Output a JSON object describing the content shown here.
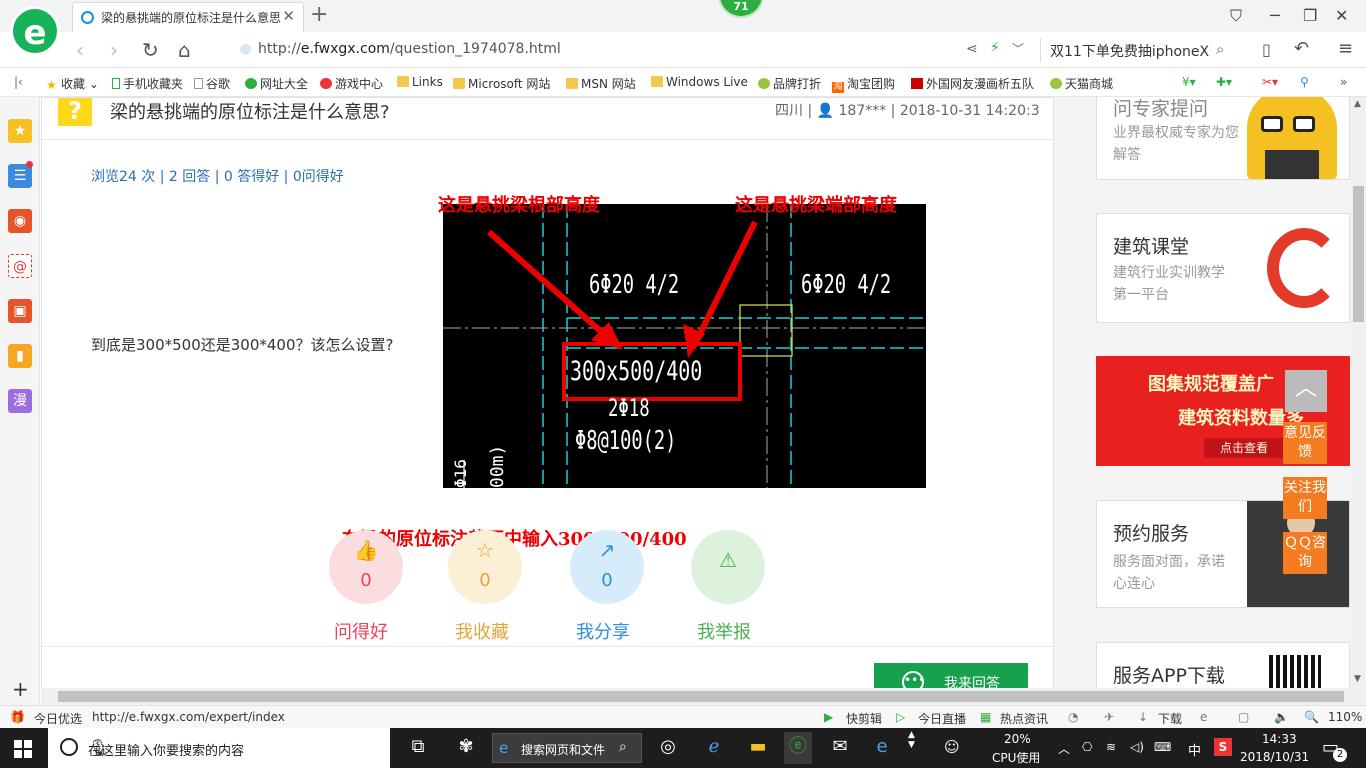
{
  "browser": {
    "tab_title": "梁的悬挑端的原位标注是什么意思",
    "badge_count": "71",
    "url_prefix": "http://",
    "url_domain": "e.fwxgx.com",
    "url_path": "/question_1974078.html",
    "search_hint": "双11下单免费抽iphoneX"
  },
  "bookmarks": [
    "收藏",
    "手机收藏夹",
    "谷歌",
    "网址大全",
    "游戏中心",
    "Links",
    "Microsoft 网站",
    "MSN 网站",
    "Windows Live",
    "品牌打折",
    "淘宝团购",
    "外国网友漫画析五队",
    "天猫商城"
  ],
  "sidebar_text": "漫",
  "question": {
    "title": "梁的悬挑端的原位标注是什么意思?",
    "meta": "四川 | 👤 187*** | 2018-10-31 14:20:3",
    "stats": "浏览24 次 | 2 回答 | 0 答得好 | 0问得好",
    "body": "到底是300*500还是300*400？该怎么设置?",
    "image": {
      "label_root": "这是悬挑梁根部高度",
      "label_end": "这是悬挑梁端部高度",
      "rebar_left": "6Φ20 4/2",
      "rebar_right": "6Φ20 4/2",
      "section": "300x500/400",
      "bottom_rebar": "2Φ18",
      "stirrup": "Φ8@100(2)",
      "side_text_1": "Φ16",
      "side_text_2": "00m)"
    },
    "caption": "在梁的原位标注截面中输入300*500/400",
    "actions": [
      {
        "label": "问得好",
        "count": "0",
        "color": "#e8445a",
        "bg": "#fbdde0"
      },
      {
        "label": "我收藏",
        "count": "0",
        "color": "#e6a23c",
        "bg": "#fbefd6"
      },
      {
        "label": "我分享",
        "count": "0",
        "color": "#2d8fe0",
        "bg": "#d6ecfb"
      },
      {
        "label": "我举报",
        "count": "",
        "color": "#4caf50",
        "bg": "#dcf2dd"
      }
    ],
    "answer_button": "我来回答"
  },
  "right": {
    "expert_title": "问专家提问",
    "expert_sub": "业界最权威专家为您解答",
    "course_title": "建筑课堂",
    "course_sub": "建筑行业实训教学第一平台",
    "banner_line1": "图集规范覆盖广",
    "banner_line2": "建筑资料数量多",
    "banner_btn": "点击查看",
    "booking_title": "预约服务",
    "booking_sub": "服务面对面，承诺心连心",
    "app_title": "服务APP下载",
    "float_feedback": "意见反馈",
    "float_follow": "关注我们",
    "float_qq": "ＱＱ咨询"
  },
  "statusbar": {
    "left_label": "今日优选",
    "hover_url": "http://e.fwxgx.com/expert/index",
    "items": [
      "快剪辑",
      "今日直播",
      "热点资讯",
      "下载"
    ],
    "zoom": "110%"
  },
  "taskbar": {
    "search_placeholder": "在这里输入你要搜索的内容",
    "browser_search": "搜索网页和文件",
    "cpu_percent": "20%",
    "cpu_label": "CPU使用",
    "ime": "中",
    "time": "14:33",
    "date": "2018/10/31",
    "notif_count": "2"
  }
}
